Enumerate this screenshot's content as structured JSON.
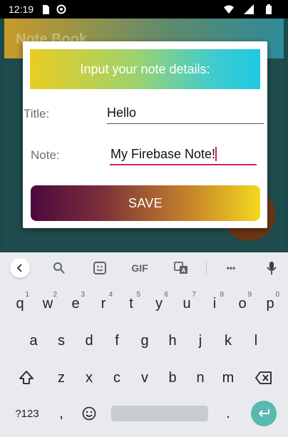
{
  "status_bar": {
    "time": "12:19",
    "left_icons": [
      "sd-card-icon",
      "data-saver-icon"
    ],
    "right_icons": [
      "wifi-icon",
      "signal-icon",
      "battery-icon"
    ]
  },
  "app": {
    "title": "Note Book"
  },
  "dialog": {
    "header": "Input your note details:",
    "title_label": "Title:",
    "title_value": "Hello",
    "note_label": "Note:",
    "note_value": "My Firebase Note!",
    "save_label": "SAVE",
    "accent_color": "#d4245e"
  },
  "keyboard": {
    "toolbar": {
      "icons": [
        "back-icon",
        "search-icon",
        "sticker-icon",
        "gif-icon",
        "translate-icon",
        "more-icon",
        "mic-icon"
      ],
      "gif_label": "GIF",
      "more_label": "•••"
    },
    "row1": [
      {
        "key": "q",
        "hint": "1"
      },
      {
        "key": "w",
        "hint": "2"
      },
      {
        "key": "e",
        "hint": "3"
      },
      {
        "key": "r",
        "hint": "4"
      },
      {
        "key": "t",
        "hint": "5"
      },
      {
        "key": "y",
        "hint": "6"
      },
      {
        "key": "u",
        "hint": "7"
      },
      {
        "key": "i",
        "hint": "8"
      },
      {
        "key": "o",
        "hint": "9"
      },
      {
        "key": "p",
        "hint": "0"
      }
    ],
    "row2": [
      "a",
      "s",
      "d",
      "f",
      "g",
      "h",
      "j",
      "k",
      "l"
    ],
    "row3": [
      "z",
      "x",
      "c",
      "v",
      "b",
      "n",
      "m"
    ],
    "bottom": {
      "symbols_label": "?123",
      "comma": ",",
      "period": "."
    },
    "enter_color": "#58b9b0"
  }
}
